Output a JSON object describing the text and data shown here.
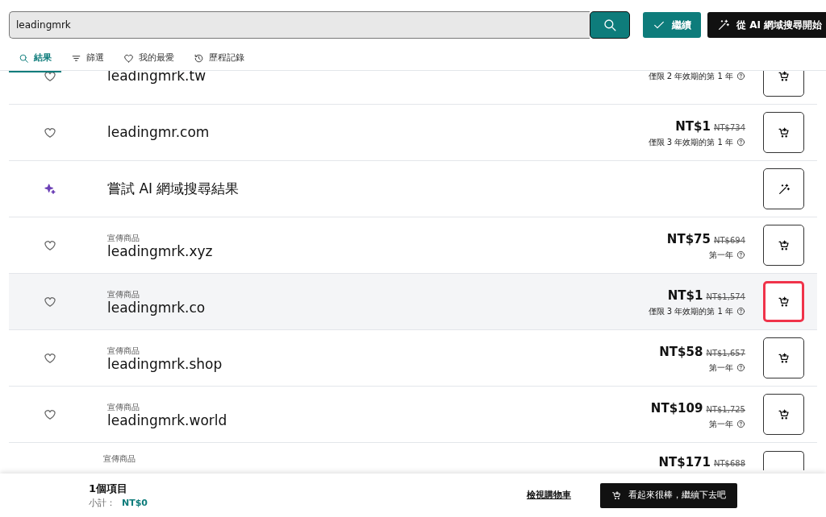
{
  "search": {
    "value": "leadingmrk"
  },
  "actions": [
    {
      "kind": "continue",
      "label": "繼續"
    },
    {
      "kind": "ai",
      "label": "從 AI 網域搜尋開始"
    }
  ],
  "tabs": [
    {
      "label": "結果",
      "kind": "search",
      "selected": true
    },
    {
      "label": "篩選",
      "kind": "filter",
      "selected": false
    },
    {
      "label": "我的最愛",
      "kind": "heart",
      "selected": false
    },
    {
      "label": "歷程記錄",
      "kind": "history",
      "selected": false
    }
  ],
  "results": [
    {
      "kind": "domain",
      "domain": "leadingmrk.tw",
      "note": "僅限 2 年效期的第 1 年",
      "highlighted": false
    },
    {
      "kind": "domain",
      "domain": "leadingmr.com",
      "price": "NT$1",
      "old_price": "NT$734",
      "note": "僅限 3 年效期的第 1 年",
      "highlighted": false
    },
    {
      "kind": "ai_suggestion",
      "label": "嘗試 AI 網域搜尋結果"
    },
    {
      "kind": "domain",
      "tag": "宣傳商品",
      "domain": "leadingmrk.xyz",
      "price": "NT$75",
      "old_price": "NT$694",
      "note": "第一年",
      "highlighted": false
    },
    {
      "kind": "domain",
      "tag": "宣傳商品",
      "domain": "leadingmrk.co",
      "price": "NT$1",
      "old_price": "NT$1,574",
      "note": "僅限 3 年效期的第 1 年",
      "highlighted": true
    },
    {
      "kind": "domain",
      "tag": "宣傳商品",
      "domain": "leadingmrk.shop",
      "price": "NT$58",
      "old_price": "NT$1,657",
      "note": "第一年",
      "highlighted": false
    },
    {
      "kind": "domain",
      "tag": "宣傳商品",
      "domain": "leadingmrk.world",
      "price": "NT$109",
      "old_price": "NT$1,725",
      "note": "第一年",
      "highlighted": false
    },
    {
      "kind": "domain",
      "tag": "宣傳商品",
      "price": "NT$171",
      "old_price": "NT$688",
      "highlighted": false
    }
  ],
  "cart": {
    "count": "1個項目",
    "subtotal_label": "小計：",
    "subtotal": "NT$0",
    "view_link": "檢視購物車",
    "checkout": "看起來很棒，繼續下去吧"
  }
}
